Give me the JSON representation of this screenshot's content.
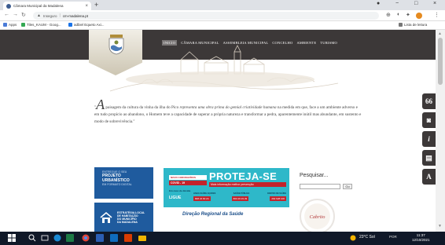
{
  "browser": {
    "tab_title": "Câmara Municipal da Madalena",
    "tab_close": "×",
    "new_tab": "+",
    "win_min": "−",
    "win_max": "□",
    "win_close": "×",
    "url_status": "Inseguro",
    "url": "cm-madalena.pt",
    "bookmarks": [
      {
        "label": "Apps"
      },
      {
        "label": "Tiles_KAUM - Goog..."
      },
      {
        "label": "adbiel Equeto Axi..."
      }
    ],
    "reading_list": "Lista de leitura"
  },
  "site": {
    "nav": [
      "INICIO",
      "CÂMARA MUNICIPAL",
      "ASSEMBLEIA MUNICIPAL",
      "CONCELHO",
      "AMBIENTE",
      "TURISMO"
    ],
    "quote_letter": "A",
    "quote_part1": " paisagem da cultura da vinha da ilha do Pico ",
    "quote_em": "representa uma obra prima do gemial criatividade humana",
    "quote_part2": " na medida em que, face a um ambiente adverso e em tudo propício ao abandono, o Homem teve a capacidade de superar a própria natureza e transformar a pedra, aparentemente inútil mas abundante, em sustento e modo de sobrevivência.\"",
    "quote_open": "\"",
    "side_buttons": [
      "66",
      "📷",
      "i",
      "📖",
      "A"
    ],
    "banner1": {
      "line1": "ENTREGUE O SEU",
      "line2": "PROJETO",
      "line3": "URBANÍSTICO",
      "line4": "EM FORMATO DIGITAL"
    },
    "banner2": {
      "line1": "ESTRATÉGIA LOCAL",
      "line2": "DE HABITAÇÃO",
      "line3": "DO MUNICÍPIO",
      "line4": "DA MADALENA"
    },
    "proteja": {
      "badge": "NOVO CORONAVÍRUS",
      "covid": "COVID - 19",
      "title": "PROTEJA-SE",
      "info": "Mais informação melhor prevenção",
      "sub": "Em caso de dúvida",
      "ligue": "LIGUE",
      "labels": [
        "LINHA SAÚDE AÇORES",
        "SAÚDE PÚBLICA",
        "CENTRO DE SAÚDE"
      ],
      "numbers": [
        "808 24 60 24",
        "800 29 29 29",
        "292 628 100"
      ]
    },
    "drs": "Direção Regional da Saúde",
    "search_label": "Pesquisar...",
    "search_go": "Go",
    "cabrito_text": "Cabrito"
  },
  "taskbar": {
    "weather": "23°C Sol",
    "lang": "POR",
    "time": "11:37",
    "date": "12/10/2021"
  },
  "colors": {
    "header": "#3c3838",
    "proteja": "#2eb8c9",
    "banner": "#1f5b9e",
    "covid_red": "#c4232b"
  }
}
